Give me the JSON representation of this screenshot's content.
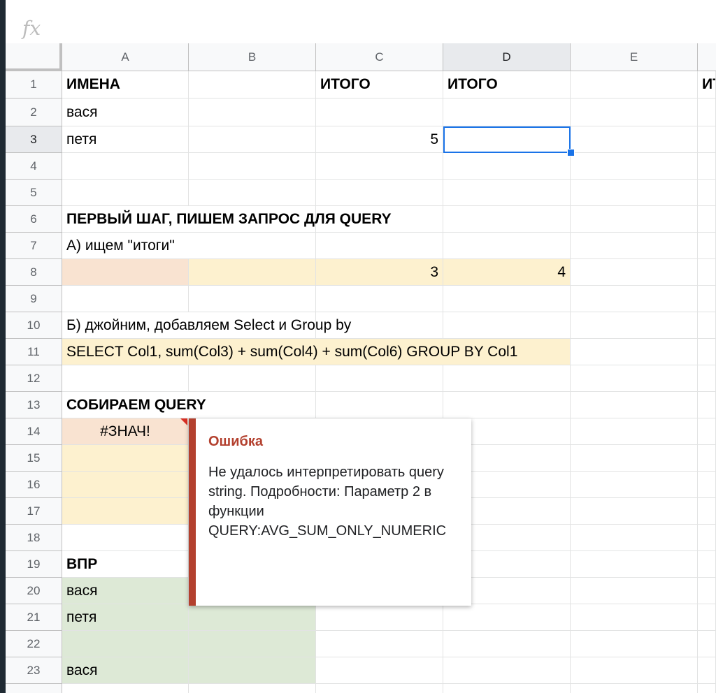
{
  "formula_bar": {
    "fx_label": "fx",
    "value": ""
  },
  "columns": [
    "A",
    "B",
    "C",
    "D",
    "E"
  ],
  "rows": [
    "1",
    "2",
    "3",
    "4",
    "5",
    "6",
    "7",
    "8",
    "9",
    "10",
    "11",
    "12",
    "13",
    "14",
    "15",
    "16",
    "17",
    "18",
    "19",
    "20",
    "21",
    "22",
    "23"
  ],
  "cells": {
    "A1": "ИМЕНА",
    "C1": "ИТОГО",
    "D1": "ИТОГО",
    "F1": "ИТ",
    "A2": "вася",
    "A3": "петя",
    "C3": "5",
    "A6": "ПЕРВЫЙ ШАГ, ПИШЕМ ЗАПРОС ДЛЯ QUERY",
    "A7": "А) ищем \"итоги\"",
    "C8": "3",
    "D8": "4",
    "A10": "Б) джойним, добавляем Select и Group by",
    "A11": " SELECT Col1, sum(Col3) + sum(Col4) + sum(Col6) GROUP BY Col1",
    "A13": "СОБИРАЕМ QUERY",
    "A14": "#ЗНАЧ!",
    "A19": "ВПР",
    "A20": "вася",
    "A21": "петя",
    "A23": "вася"
  },
  "error_popup": {
    "title": "Ошибка",
    "message": "Не удалось интерпретировать query string. Подробности: Параметр 2 в функции QUERY:AVG_SUM_ONLY_NUMERIC"
  },
  "colors": {
    "selection": "#1a73e8",
    "highlight_orange": "#f9e3d1",
    "highlight_yellow": "#fdf1cf",
    "highlight_green": "#dde9d6",
    "error_accent": "#b3402e"
  }
}
